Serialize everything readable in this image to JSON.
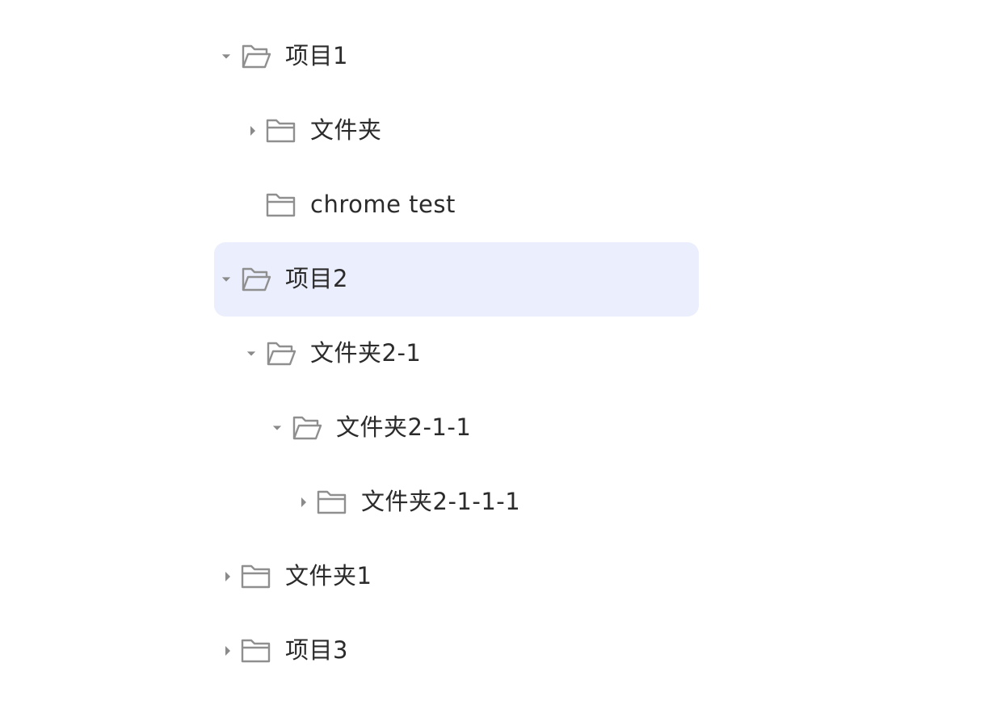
{
  "tree": {
    "items": [
      {
        "label": "项目1",
        "state": "expanded",
        "icon": "folder-open-icon"
      },
      {
        "label": "文件夹",
        "state": "collapsed",
        "icon": "folder-icon"
      },
      {
        "label": "chrome test",
        "state": "leaf",
        "icon": "folder-icon"
      },
      {
        "label": "项目2",
        "state": "expanded",
        "icon": "folder-open-icon",
        "selected": true
      },
      {
        "label": "文件夹2-1",
        "state": "expanded",
        "icon": "folder-open-icon"
      },
      {
        "label": "文件夹2-1-1",
        "state": "expanded",
        "icon": "folder-open-icon"
      },
      {
        "label": "文件夹2-1-1-1",
        "state": "collapsed",
        "icon": "folder-icon"
      },
      {
        "label": "文件夹1",
        "state": "collapsed",
        "icon": "folder-icon"
      },
      {
        "label": "项目3",
        "state": "collapsed",
        "icon": "folder-icon"
      }
    ]
  },
  "colors": {
    "selected_bg": "#ebeefc",
    "icon": "#8f8f8f",
    "text": "#2b2b2b"
  }
}
